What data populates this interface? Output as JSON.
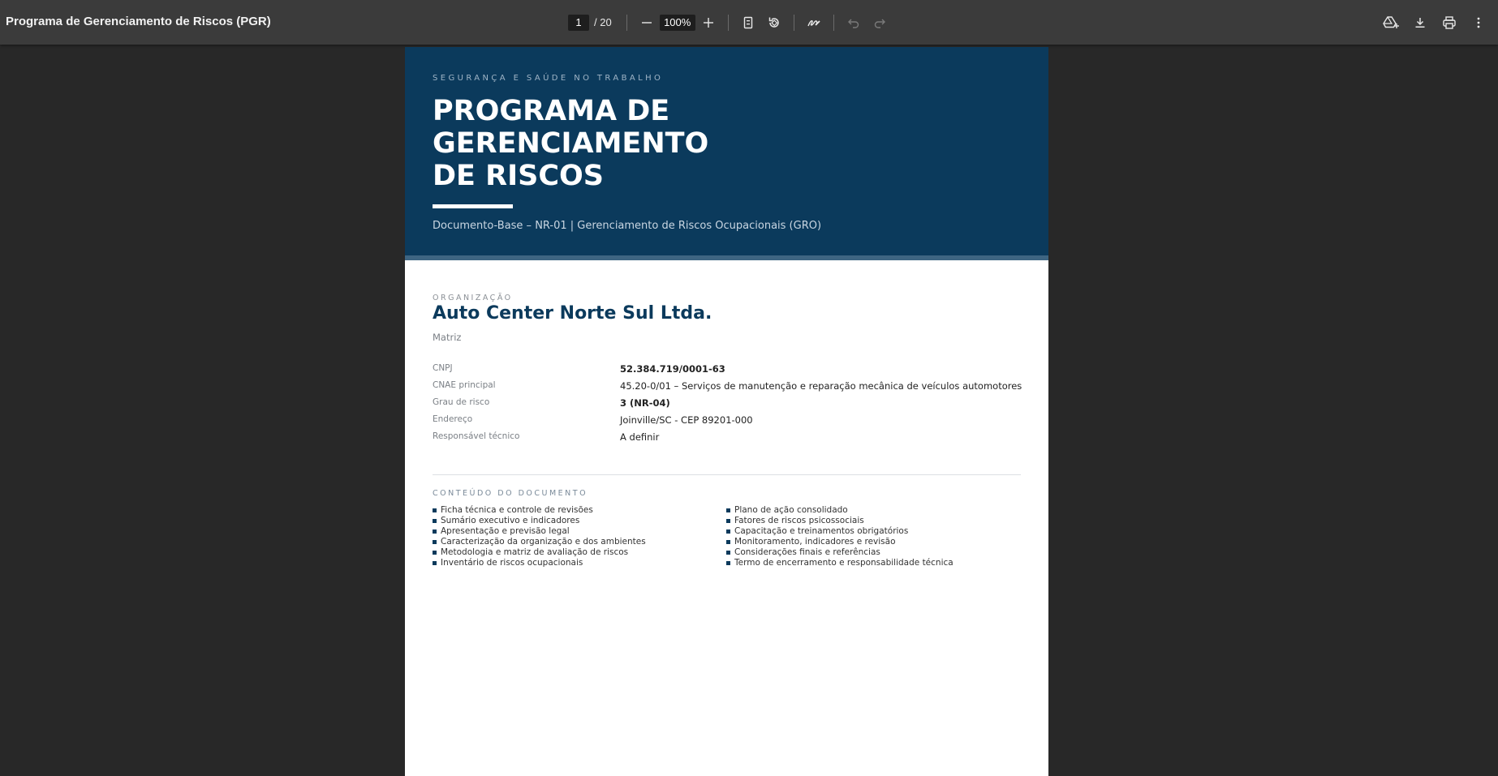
{
  "toolbar": {
    "title": "Programa de Gerenciamento de Riscos (PGR)",
    "page_current": "1",
    "page_total": "/ 20",
    "zoom": "100%"
  },
  "document": {
    "kicker": "SEGURANÇA E SAÚDE NO TRABALHO",
    "title_lines": [
      "PROGRAMA DE",
      "GERENCIAMENTO",
      "DE RISCOS"
    ],
    "subtitle": "Documento-Base – NR-01  |  Gerenciamento de Riscos Ocupacionais (GRO)",
    "org_kicker": "ORGANIZAÇÃO",
    "org_name": "Auto Center Norte Sul Ltda.",
    "org_unit": "Matriz",
    "info": [
      {
        "label": "CNPJ",
        "value": "52.384.719/0001-63"
      },
      {
        "label": "CNAE principal",
        "value": "45.20-0/01 – Serviços de manutenção e reparação mecânica de veículos automotores"
      },
      {
        "label": "Grau de risco",
        "value": "3 (NR-04)"
      },
      {
        "label": "Endereço",
        "value": "Joinville/SC - CEP 89201-000"
      },
      {
        "label": "Responsável técnico",
        "value": "A definir"
      }
    ],
    "toc_kicker": "CONTEÚDO DO DOCUMENTO",
    "toc_left": [
      "Ficha técnica e controle de revisões",
      "Sumário executivo e indicadores",
      "Apresentação e previsão legal",
      "Caracterização da organização e dos ambientes",
      "Metodologia e matriz de avaliação de riscos",
      "Inventário de riscos ocupacionais"
    ],
    "toc_right": [
      "Plano de ação consolidado",
      "Fatores de riscos psicossociais",
      "Capacitação e treinamentos obrigatórios",
      "Monitoramento, indicadores e revisão",
      "Considerações finais e referências",
      "Termo de encerramento e responsabilidade técnica"
    ]
  }
}
